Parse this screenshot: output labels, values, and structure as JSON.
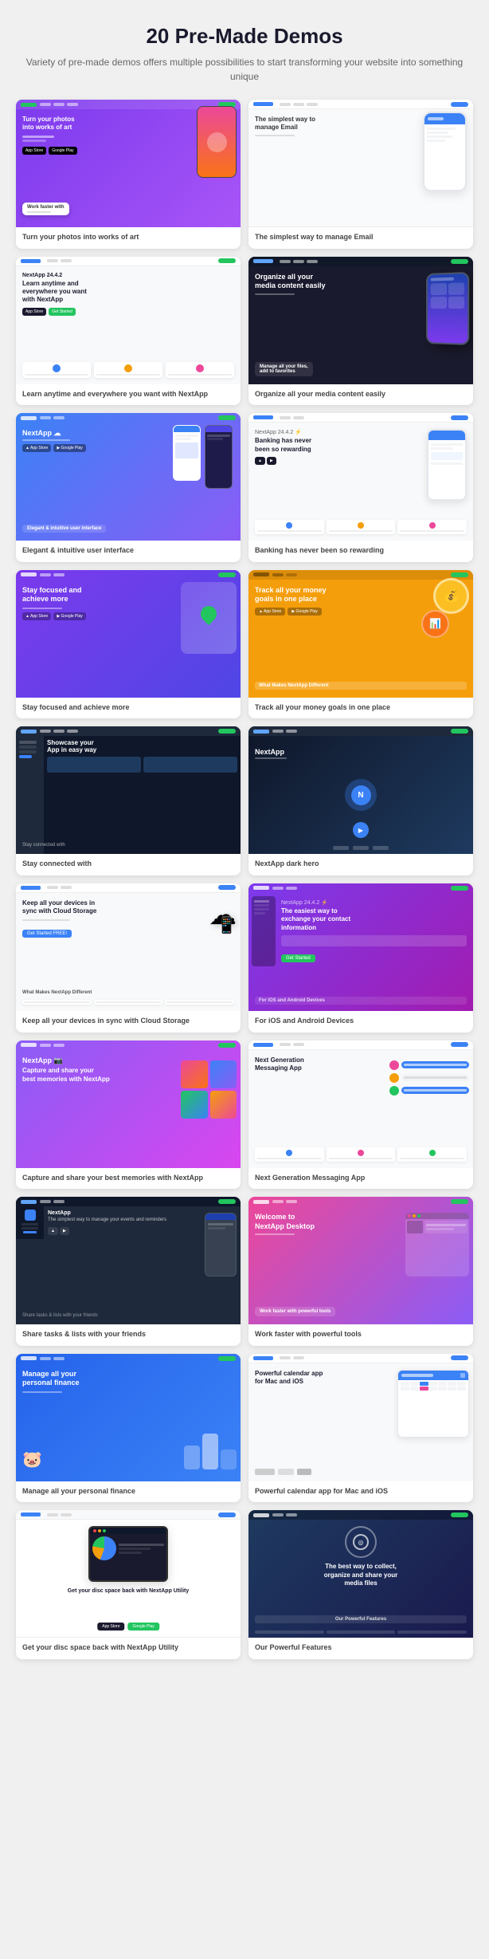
{
  "page": {
    "title": "20 Pre-Made Demos",
    "subtitle": "Variety of pre-made demos offers multiple possibilities\nto start transforming your website into something unique"
  },
  "demos": [
    {
      "id": 1,
      "label": "Turn your photos into works of art",
      "theme": "purple",
      "sublabel": "Work faster with"
    },
    {
      "id": 2,
      "label": "The simplest way to manage Email",
      "theme": "white",
      "sublabel": ""
    },
    {
      "id": 3,
      "label": "Learn anytime and everywhere you want with NextApp",
      "theme": "light",
      "sublabel": ""
    },
    {
      "id": 4,
      "label": "Organize all your media content easily",
      "theme": "dark",
      "sublabel": "Manage all your files, add to favorites"
    },
    {
      "id": 5,
      "label": "NextApp — Elegant & intuitive user interface",
      "theme": "blue",
      "sublabel": "Elegant & intuitive user interface"
    },
    {
      "id": 6,
      "label": "Banking has never been so rewarding",
      "theme": "light",
      "sublabel": ""
    },
    {
      "id": 7,
      "label": "Stay focused and achieve more",
      "theme": "purple",
      "sublabel": ""
    },
    {
      "id": 8,
      "label": "Track all your money goals in one place",
      "theme": "yellow",
      "sublabel": "What Makes NextApp Different"
    },
    {
      "id": 9,
      "label": "Showcase your App in easy way",
      "theme": "dark",
      "sublabel": "Stay connected with"
    },
    {
      "id": 10,
      "label": "NextApp dark hero",
      "theme": "dark-blue",
      "sublabel": ""
    },
    {
      "id": 11,
      "label": "Keep all your devices in sync with Cloud Storage",
      "theme": "light",
      "sublabel": "What Makes NextApp Different"
    },
    {
      "id": 12,
      "label": "The easiest way to exchange your contact information",
      "theme": "purple-dark",
      "sublabel": "For iOS and Android Devices"
    },
    {
      "id": 13,
      "label": "Capture and share your best memories with NextApp",
      "theme": "purple-pink",
      "sublabel": ""
    },
    {
      "id": 14,
      "label": "Next Generation Messaging App",
      "theme": "light",
      "sublabel": ""
    },
    {
      "id": 15,
      "label": "The simplest way to manage your events and reminders",
      "theme": "dark",
      "sublabel": "Share tasks & lists with your friends"
    },
    {
      "id": 16,
      "label": "Welcome to NextApp Desktop",
      "theme": "pink-purple",
      "sublabel": "Work faster with powerful tools"
    },
    {
      "id": 17,
      "label": "Manage all your personal finance",
      "theme": "blue-finance",
      "sublabel": ""
    },
    {
      "id": 18,
      "label": "Powerful calendar app for Mac and iOS",
      "theme": "light",
      "sublabel": ""
    },
    {
      "id": 19,
      "label": "Get your disc space back with NextApp Utility",
      "theme": "white",
      "sublabel": ""
    },
    {
      "id": 20,
      "label": "The best way to collect, organize and share your media files",
      "theme": "dark-navy",
      "sublabel": "Our Powerful Features"
    }
  ]
}
